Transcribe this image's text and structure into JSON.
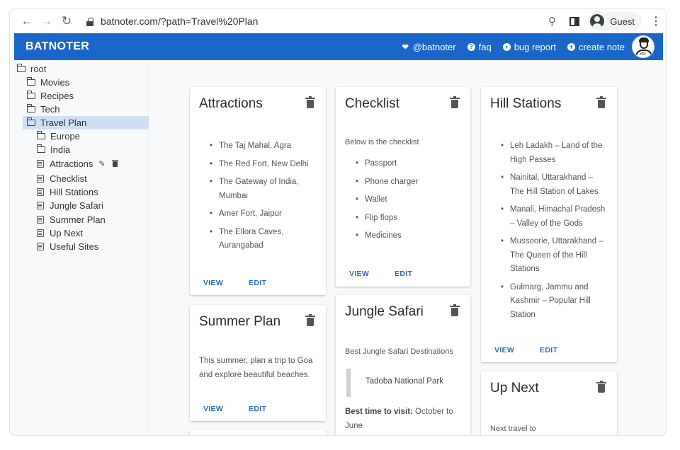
{
  "browser": {
    "url": "batnoter.com/?path=Travel%20Plan",
    "profile_name": "Guest"
  },
  "appbar": {
    "brand": "BATNOTER",
    "links": [
      {
        "icon": "twitter-icon",
        "label": "@batnoter"
      },
      {
        "icon": "help-icon",
        "label": "faq"
      },
      {
        "icon": "bug-icon",
        "label": "bug report"
      },
      {
        "icon": "plus-circle-icon",
        "label": "create note"
      }
    ]
  },
  "sidebar": {
    "root": "root",
    "folders": [
      "Movies",
      "Recipes",
      "Tech",
      "Travel Plan"
    ],
    "selected": "Travel Plan",
    "subfolders": [
      "Europe",
      "India"
    ],
    "notes": [
      "Attractions",
      "Checklist",
      "Hill Stations",
      "Jungle Safari",
      "Summer Plan",
      "Up Next",
      "Useful Sites"
    ],
    "hovered_note": "Attractions"
  },
  "cards": {
    "view_label": "VIEW",
    "edit_label": "EDIT",
    "attractions": {
      "title": "Attractions",
      "items": [
        "The Taj Mahal, Agra",
        "The Red Fort, New Delhi",
        "The Gateway of India, Mumbai",
        "Amer Fort, Jaipur",
        "The Ellora Caves, Aurangabad"
      ]
    },
    "checklist": {
      "title": "Checklist",
      "intro": "Below is the checklist",
      "items": [
        "Passport",
        "Phone charger",
        "Wallet",
        "Flip flops",
        "Medicines"
      ]
    },
    "hill_stations": {
      "title": "Hill Stations",
      "items": [
        "Leh Ladakh – Land of the High Passes",
        "Nainital, Uttarakhand – The Hill Station of Lakes",
        "Manali, Himachal Pradesh – Valley of the Gods",
        "Mussoorie, Uttarakhand – The Queen of the Hill Stations",
        "Gulmarg, Jammu and Kashmir – Popular Hill Station"
      ]
    },
    "summer_plan": {
      "title": "Summer Plan",
      "text": "This summer, plan a trip to Goa and explore beautiful beaches."
    },
    "jungle_safari": {
      "title": "Jungle Safari",
      "intro": "Best Jungle Safari Destinations",
      "quote": "Tadoba National Park",
      "best_time_label": "Best time to visit:",
      "best_time_value": " October to June"
    },
    "up_next": {
      "title": "Up Next",
      "text": "Next travel to"
    }
  }
}
